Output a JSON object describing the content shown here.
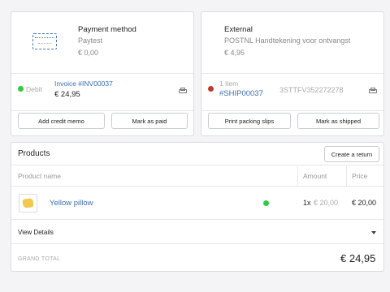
{
  "payment": {
    "title": "Payment method",
    "provider": "Paytest",
    "fee": "€ 0,00",
    "status": "Debit",
    "status_color": "#2ecc40",
    "invoice_link": "Invoice #INV00037",
    "amount": "€ 24,95",
    "btn_credit": "Add credit memo",
    "btn_paid": "Mark as paid"
  },
  "shipping": {
    "title": "External",
    "method": "POSTNL Handtekening voor ontvangst",
    "fee": "€ 4,95",
    "status_color": "#c0392b",
    "items": "1 item",
    "shipment_link": "#SHIP00037",
    "tracking": "3STTFV352272278",
    "btn_print": "Print packing slips",
    "btn_shipped": "Mark as shipped"
  },
  "products": {
    "title": "Products",
    "btn_return": "Create a return",
    "columns": {
      "name": "Product name",
      "amount": "Amount",
      "price": "Price"
    },
    "rows": [
      {
        "name": "Yellow pillow",
        "qty": "1x",
        "unit": "€ 20,00",
        "price": "€ 20,00",
        "status_color": "#2ecc40"
      }
    ],
    "view_details": "View Details",
    "grand_total_label": "GRAND TOTAL",
    "grand_total": "€ 24,95"
  }
}
